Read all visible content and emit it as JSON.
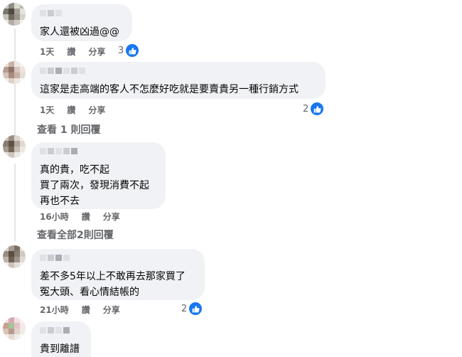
{
  "colors": {
    "like_blue": "#1877f2",
    "bubble_bg": "#f0f2f5",
    "meta_gray": "#65676b"
  },
  "comments": [
    {
      "text": "家人還被凶過@@",
      "time": "1天",
      "reply": "讚",
      "share": "分享",
      "likes": "3"
    },
    {
      "text": "這家是走高端的客人不怎麼好吃就是要賣貴另一種行銷方式",
      "time": "1天",
      "reply": "讚",
      "share": "分享",
      "likes": "2",
      "view_replies": "查看 1 則回覆"
    },
    {
      "text": "真的貴，吃不起\n買了兩次，發現消費不起\n再也不去",
      "time": "16小時",
      "reply": "讚",
      "share": "分享",
      "view_replies": "查看全部2則回覆"
    },
    {
      "text": "差不多5年以上不敢再去那家買了\n冤大頭、看心情結帳的",
      "time": "21小時",
      "reply": "讚",
      "share": "分享",
      "likes": "2"
    },
    {
      "text": "貴到離譜"
    }
  ],
  "icons": {
    "like": "thumbs-up-icon",
    "avatar": "pixelated-avatar"
  }
}
